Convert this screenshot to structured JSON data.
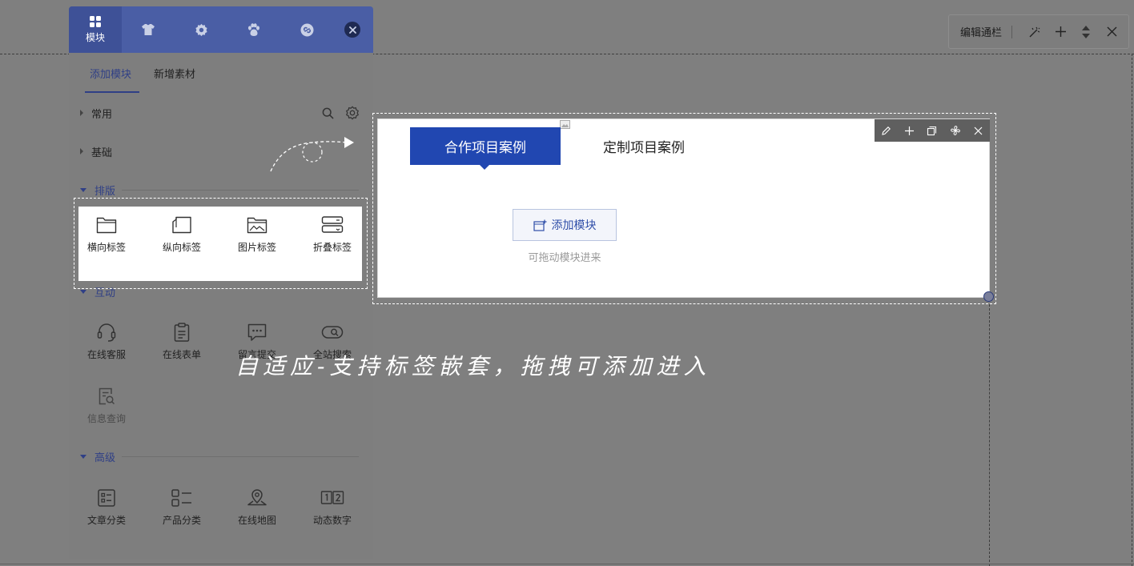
{
  "panel": {
    "tabs": [
      {
        "label": "模块",
        "icon": "grid-icon"
      },
      {
        "label": "",
        "icon": "shirt-icon"
      },
      {
        "label": "",
        "icon": "gear-icon"
      },
      {
        "label": "",
        "icon": "paw-icon"
      },
      {
        "label": "",
        "icon": "link-icon"
      }
    ],
    "subtabs": {
      "add_module": "添加模块",
      "new_asset": "新增素材"
    },
    "categories": {
      "common": "常用",
      "basic": "基础",
      "layout": "排版",
      "interactive": "互动",
      "advanced": "高级"
    },
    "layout_items": [
      "横向标签",
      "纵向标签",
      "图片标签",
      "折叠标签"
    ],
    "interactive_items": [
      "在线客服",
      "在线表单",
      "留言提交",
      "全站搜索",
      "信息查询"
    ],
    "advanced_items": [
      "文章分类",
      "产品分类",
      "在线地图",
      "动态数字"
    ]
  },
  "module": {
    "tab_active": "合作项目案例",
    "tab_other": "定制项目案例",
    "add_button": "添加模块",
    "drag_hint": "可拖动模块进来"
  },
  "editbar": {
    "label": "编辑通栏"
  },
  "caption": "自适应-支持标签嵌套，拖拽可添加进入",
  "colors": {
    "accent": "#2147b1",
    "panel_header": "#4a5ea5"
  }
}
